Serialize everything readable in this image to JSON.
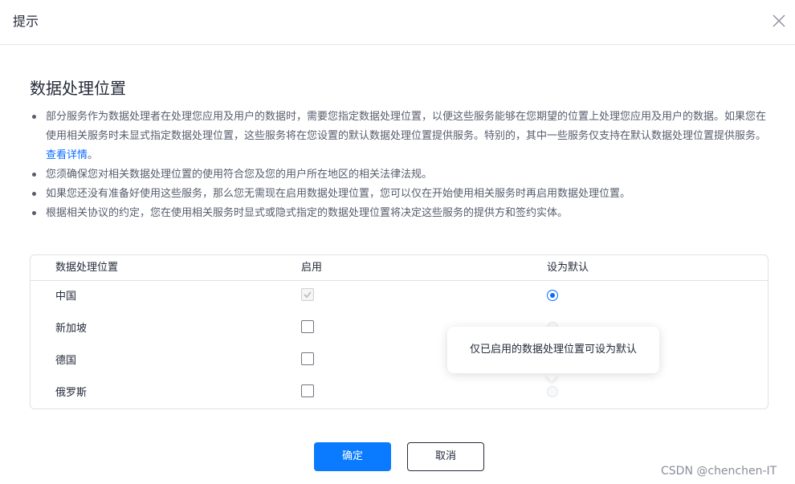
{
  "header": {
    "title": "提示",
    "close_icon": "close-icon"
  },
  "section": {
    "title": "数据处理位置",
    "bullets": [
      {
        "text": "部分服务作为数据处理者在处理您应用及用户的数据时，需要您指定数据处理位置，以便这些服务能够在您期望的位置上处理您应用及用户的数据。如果您在使用相关服务时未显式指定数据处理位置，这些服务将在您设置的默认数据处理位置提供服务。特别的，其中一些服务仅支持在默认数据处理位置提供服务。",
        "link": "查看详情",
        "suffix": "。"
      },
      {
        "text": "您须确保您对相关数据处理位置的使用符合您及您的用户所在地区的相关法律法规。"
      },
      {
        "text": "如果您还没有准备好使用这些服务，那么您无需现在启用数据处理位置，您可以仅在开始使用相关服务时再启用数据处理位置。"
      },
      {
        "text": "根据相关协议的约定，您在使用相关服务时显式或隐式指定的数据处理位置将决定这些服务的提供方和签约实体。"
      }
    ]
  },
  "table": {
    "columns": [
      "数据处理位置",
      "启用",
      "设为默认"
    ],
    "rows": [
      {
        "label": "中国",
        "enabled": true,
        "enabled_disabled": true,
        "default": true
      },
      {
        "label": "新加坡",
        "enabled": false,
        "default": false
      },
      {
        "label": "德国",
        "enabled": false,
        "default": false
      },
      {
        "label": "俄罗斯",
        "enabled": false,
        "default": false
      }
    ]
  },
  "tooltip": {
    "text": "仅已启用的数据处理位置可设为默认"
  },
  "footer": {
    "confirm_label": "确定",
    "cancel_label": "取消"
  },
  "watermark": "CSDN @chenchen-IT",
  "colors": {
    "primary": "#0a7bff",
    "link": "#0a6cff",
    "text": "#252b3a",
    "muted": "#575d6c"
  }
}
